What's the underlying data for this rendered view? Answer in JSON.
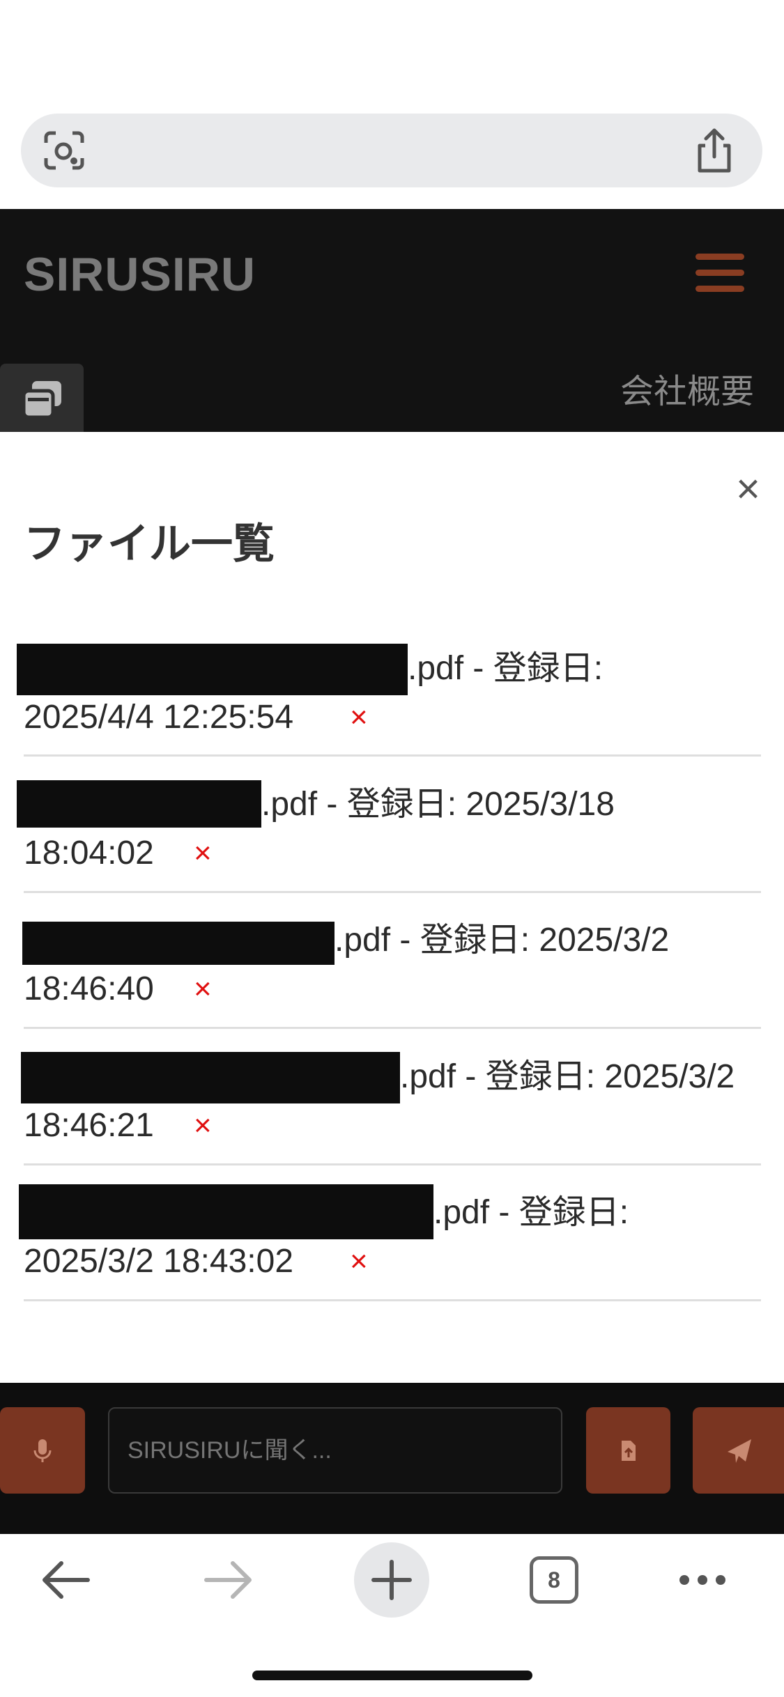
{
  "header": {
    "brand": "SIRUSIRU",
    "nav_company": "会社概要"
  },
  "modal": {
    "title": "ファイル一覧",
    "close_label": "×",
    "delete_label": "×",
    "files": [
      {
        "line1": ".pdf - 登録日:",
        "line2": "2025/4/4 12:25:54"
      },
      {
        "line1": ".pdf - 登録日: 2025/3/18",
        "line2": "18:04:02"
      },
      {
        "line1": ".pdf - 登録日: 2025/3/2",
        "line2": "18:46:40"
      },
      {
        "line1": ".pdf - 登録日: 2025/3/2",
        "line2": "18:46:21"
      },
      {
        "line1": ".pdf - 登録日:",
        "line2": "2025/3/2 18:43:02"
      }
    ]
  },
  "chat": {
    "placeholder": "SIRUSIRUに聞く..."
  },
  "toolbar": {
    "tab_count": "8"
  },
  "colors": {
    "accent": "#7a3521",
    "delete": "#e01010",
    "header_bg": "#121212"
  },
  "icons": [
    "lens-icon",
    "share-icon",
    "hamburger-icon",
    "copy-icon",
    "close-icon",
    "mic-icon",
    "file-upload-icon",
    "send-icon",
    "back-arrow-icon",
    "forward-arrow-icon",
    "plus-icon",
    "tabs-icon",
    "more-icon"
  ]
}
